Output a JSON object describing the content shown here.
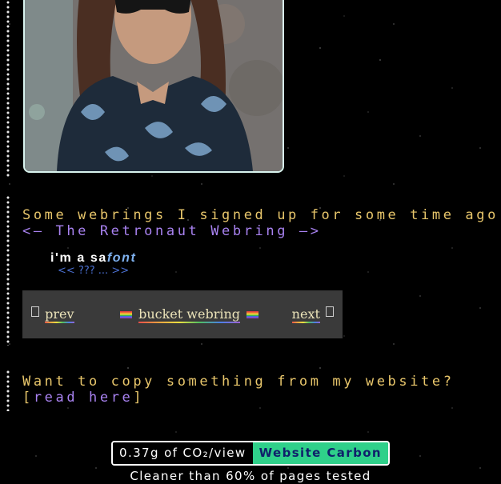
{
  "webrings": {
    "intro": "Some webrings I signed up for some time ago.",
    "retronaut_link": "<— The Retronaut Webring —>",
    "safont": {
      "prefix": "i'm a sa",
      "font_word": "font",
      "prev": "<<",
      "random": "???",
      "list": "...",
      "next": ">>"
    },
    "bucket": {
      "prev": "prev",
      "title": "bucket webring",
      "next": "next"
    }
  },
  "copy": {
    "prefix": "Want to copy something from my website? [",
    "link": "read here",
    "suffix": "]"
  },
  "carbon": {
    "value": "0.37g of CO₂/view",
    "brand": "Website Carbon",
    "subtitle": "Cleaner than 60% of pages tested"
  },
  "colors": {
    "background": "#000000",
    "text_gold": "#e8c66b",
    "link_purple": "#a882f0",
    "carbon_green": "#2fd08a"
  }
}
